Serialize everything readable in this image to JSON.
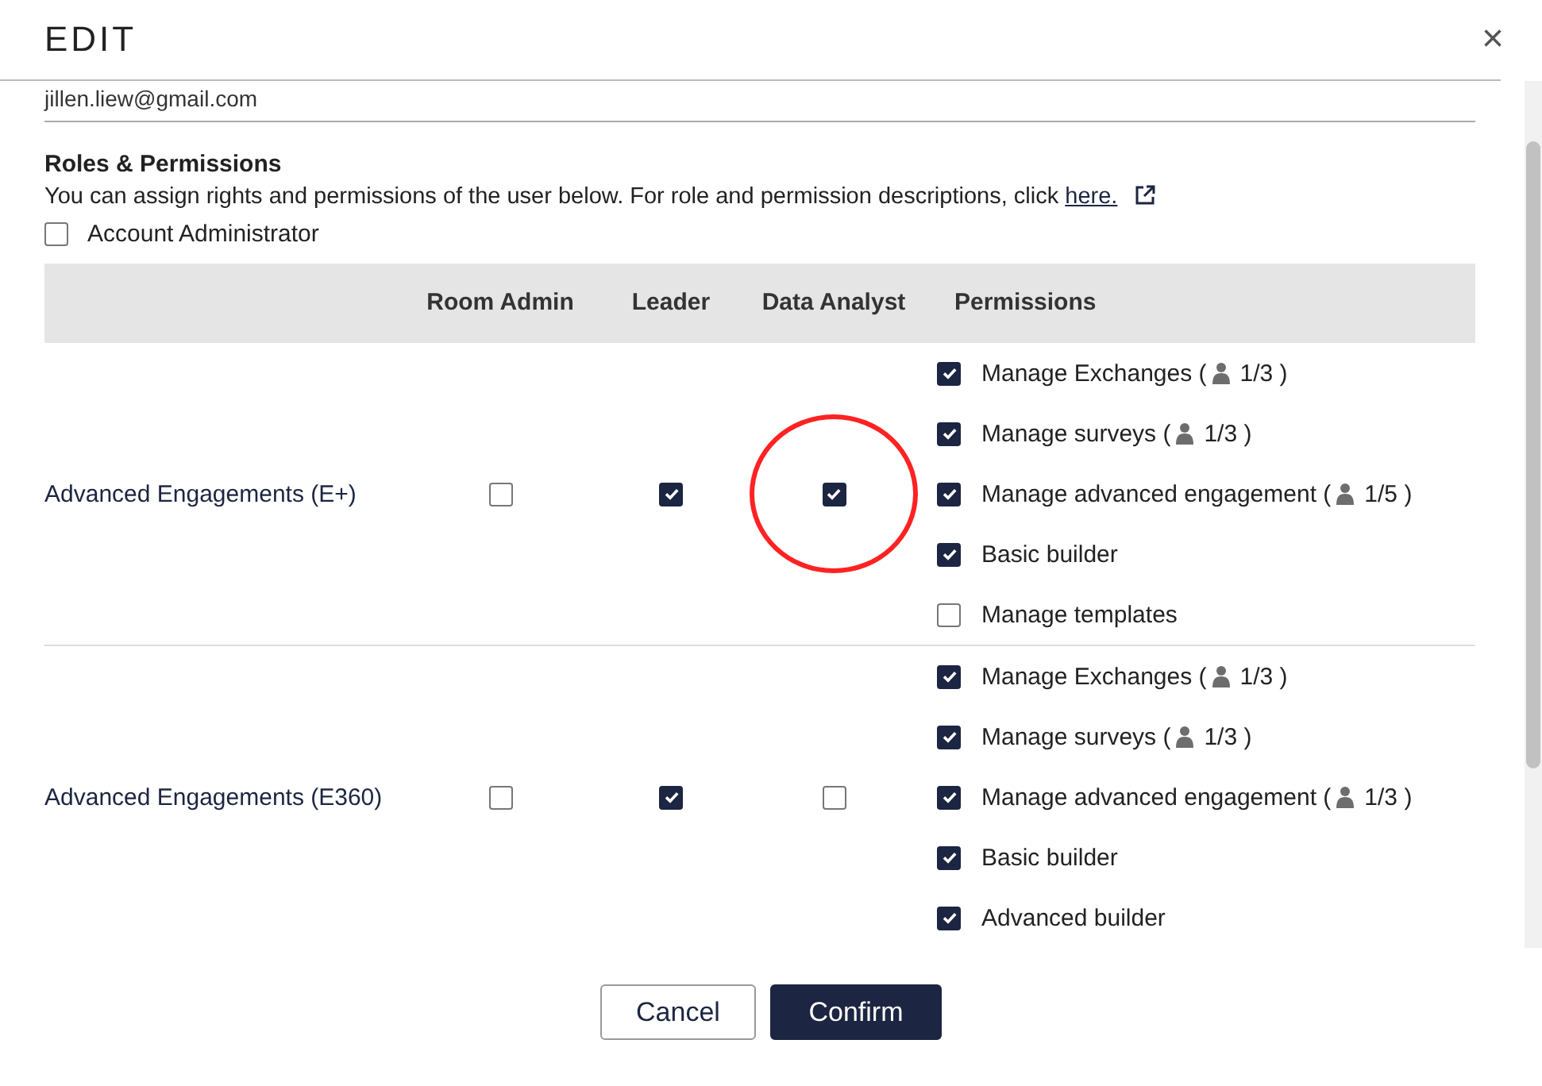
{
  "dialog": {
    "title": "EDIT",
    "close": "×"
  },
  "email": "jillen.liew@gmail.com",
  "roles_section": {
    "heading": "Roles & Permissions",
    "description": "You can assign rights and permissions of the user below. For role and permission descriptions, click ",
    "link": "here.",
    "account_admin": {
      "label": "Account Administrator",
      "checked": false
    }
  },
  "table": {
    "columns": [
      "Room Admin",
      "Leader",
      "Data Analyst",
      "Permissions"
    ],
    "rows": [
      {
        "name": "Advanced Engagements (E+)",
        "roles": [
          {
            "checked": false,
            "circled": false
          },
          {
            "checked": true,
            "circled": false
          },
          {
            "checked": true,
            "circled": true
          }
        ],
        "permissions": [
          {
            "label": "Manage Exchanges (",
            "count": "1/3 )",
            "checked": true
          },
          {
            "label": "Manage surveys (",
            "count": "1/3 )",
            "checked": true
          },
          {
            "label": "Manage advanced engagement (",
            "count": "1/5 )",
            "checked": true
          },
          {
            "label": "Basic builder",
            "checked": true
          },
          {
            "label": "Manage templates",
            "checked": false
          }
        ]
      },
      {
        "name": "Advanced Engagements (E360)",
        "roles": [
          {
            "checked": false,
            "circled": false
          },
          {
            "checked": true,
            "circled": false
          },
          {
            "checked": false,
            "circled": false
          }
        ],
        "permissions": [
          {
            "label": "Manage Exchanges (",
            "count": "1/3 )",
            "checked": true
          },
          {
            "label": "Manage surveys (",
            "count": "1/3 )",
            "checked": true
          },
          {
            "label": "Manage advanced engagement (",
            "count": "1/3 )",
            "checked": true
          },
          {
            "label": "Basic builder",
            "checked": true
          },
          {
            "label": "Advanced builder",
            "checked": true
          }
        ]
      }
    ]
  },
  "buttons": {
    "cancel": "Cancel",
    "confirm": "Confirm"
  }
}
